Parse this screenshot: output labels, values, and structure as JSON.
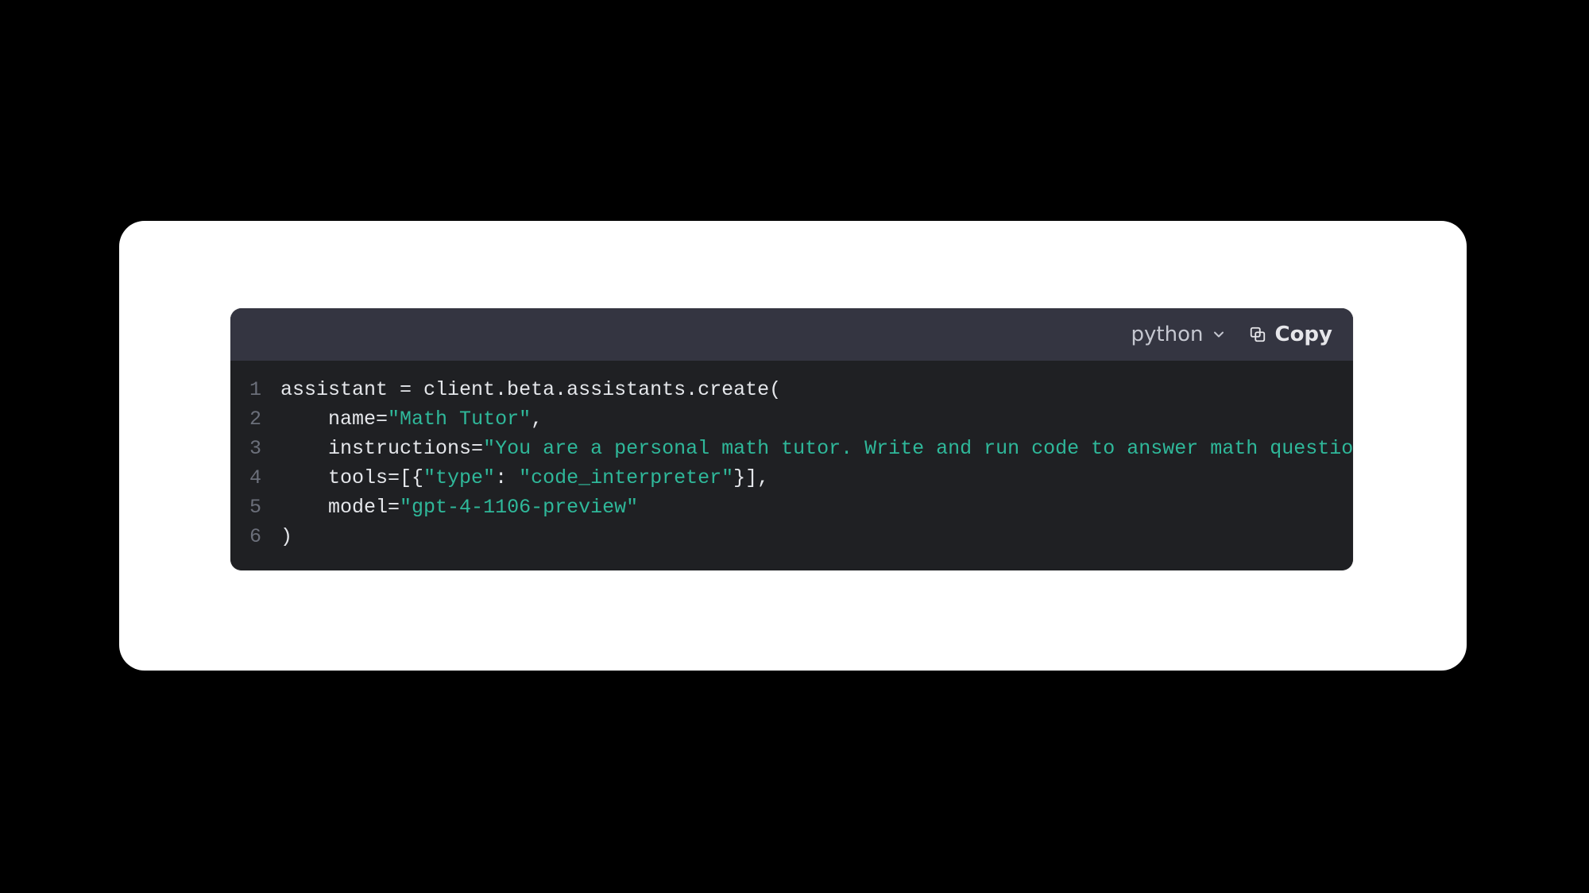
{
  "header": {
    "language": "python",
    "copy_label": "Copy"
  },
  "code": {
    "line_numbers": [
      "1",
      "2",
      "3",
      "4",
      "5",
      "6"
    ],
    "lines": [
      [
        {
          "t": "assistant = client.beta.assistants.create(",
          "c": "default"
        }
      ],
      [
        {
          "t": "    name=",
          "c": "default"
        },
        {
          "t": "\"Math Tutor\"",
          "c": "str"
        },
        {
          "t": ",",
          "c": "default"
        }
      ],
      [
        {
          "t": "    instructions=",
          "c": "default"
        },
        {
          "t": "\"You are a personal math tutor. Write and run code to answer math questions",
          "c": "str"
        }
      ],
      [
        {
          "t": "    tools=[{",
          "c": "default"
        },
        {
          "t": "\"type\"",
          "c": "str"
        },
        {
          "t": ": ",
          "c": "default"
        },
        {
          "t": "\"code_interpreter\"",
          "c": "str"
        },
        {
          "t": "}],",
          "c": "default"
        }
      ],
      [
        {
          "t": "    model=",
          "c": "default"
        },
        {
          "t": "\"gpt-4-1106-preview\"",
          "c": "str"
        }
      ],
      [
        {
          "t": ")",
          "c": "default"
        }
      ]
    ]
  }
}
